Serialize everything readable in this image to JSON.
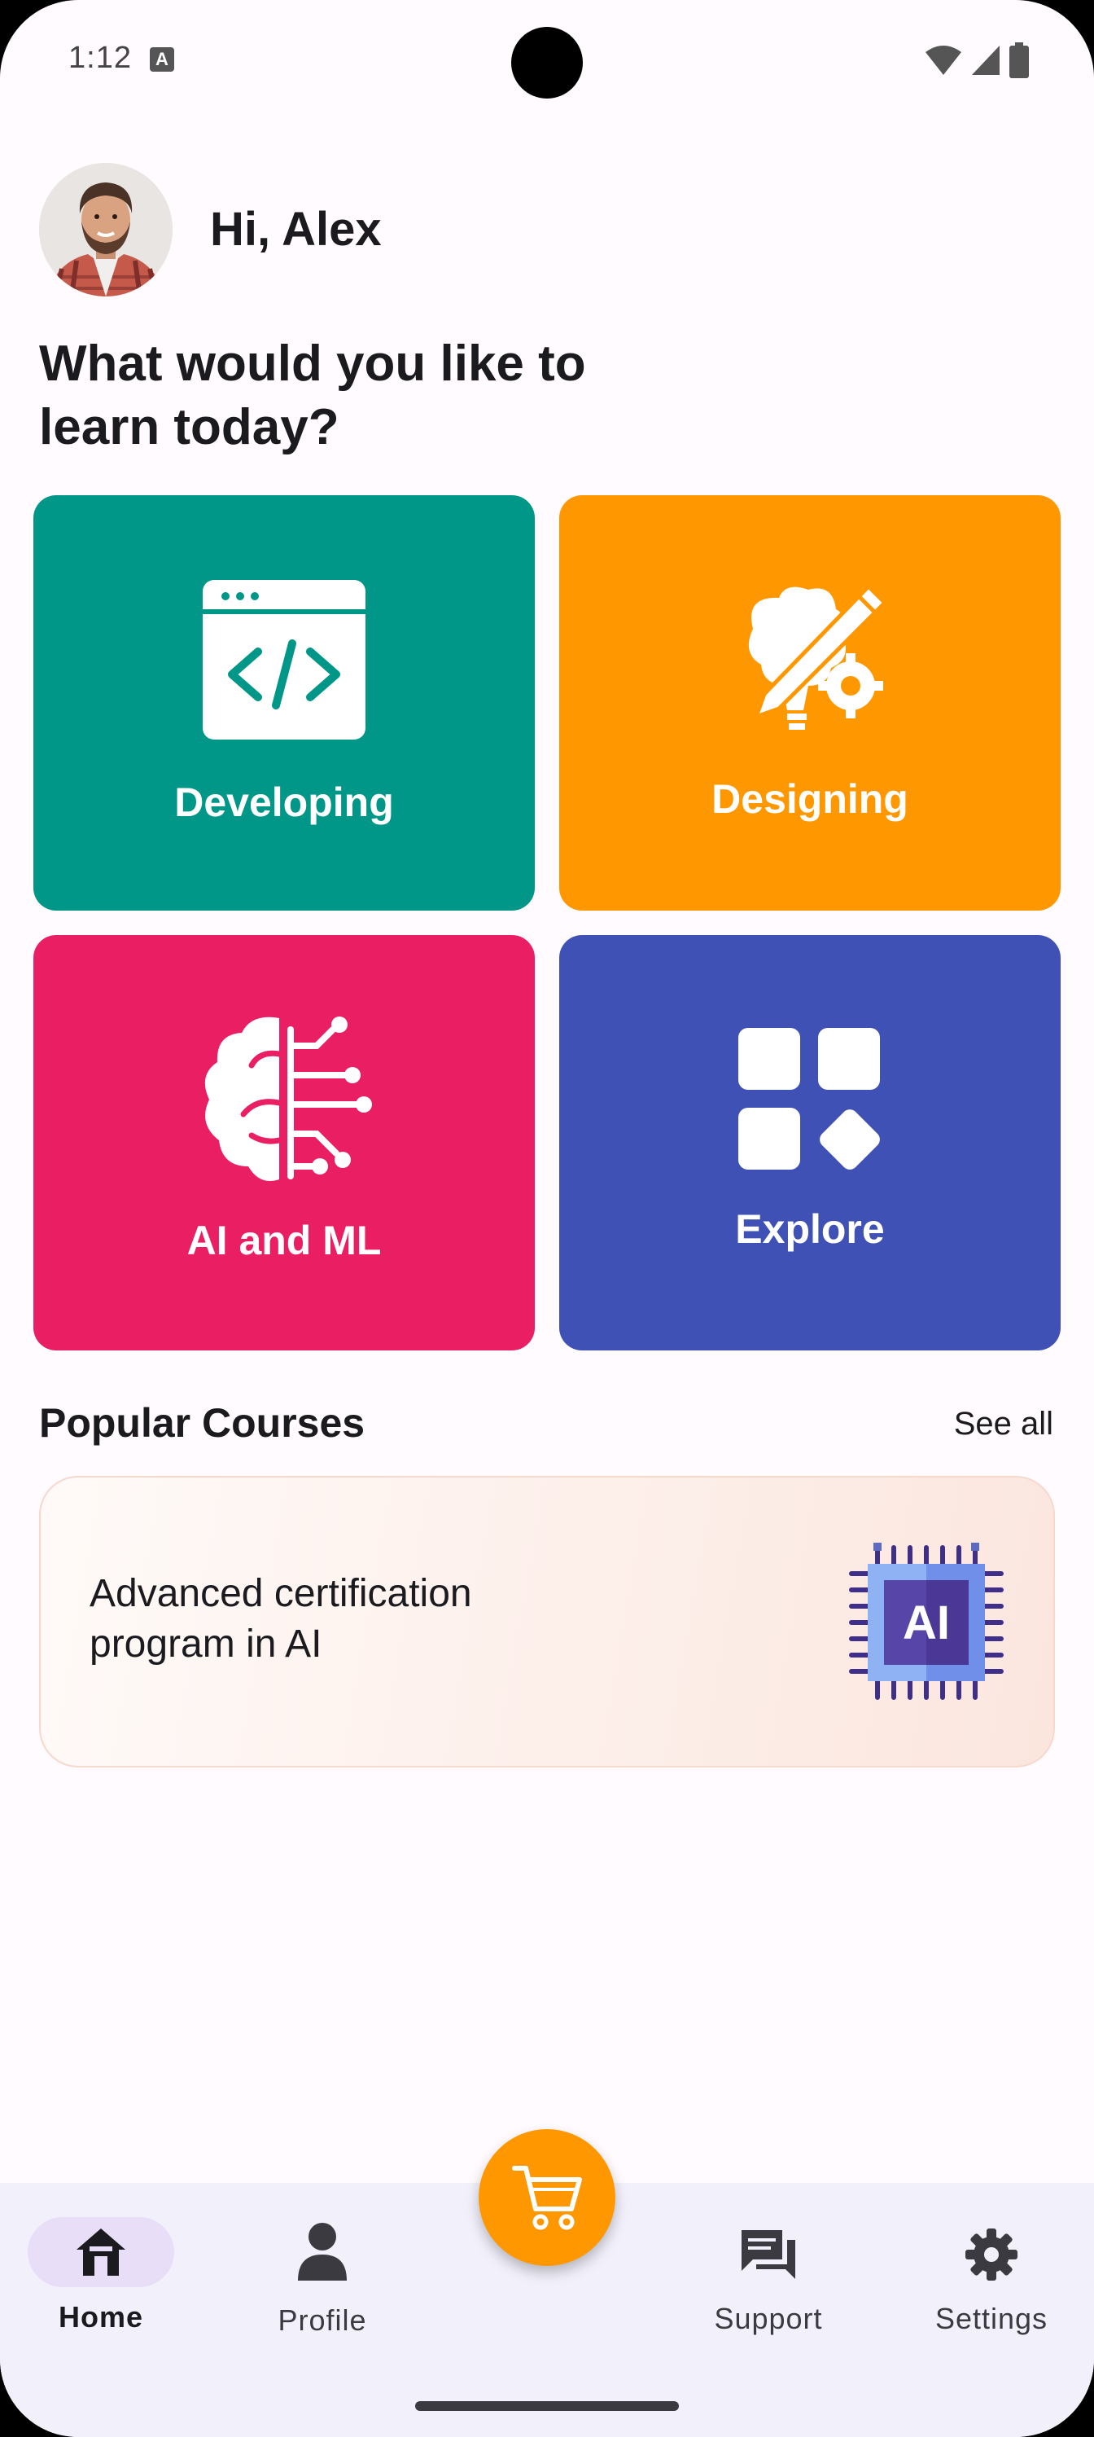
{
  "status_bar": {
    "time": "1:12",
    "notification_icon": "a-icon"
  },
  "user": {
    "greeting": "Hi, Alex",
    "avatar_icon": "avatar"
  },
  "headline": "What would you like to learn today?",
  "categories": [
    {
      "label": "Developing",
      "icon": "code-window-icon",
      "color": "#009688"
    },
    {
      "label": "Designing",
      "icon": "design-brain-pencil-icon",
      "color": "#ff9800"
    },
    {
      "label": "AI and ML",
      "icon": "brain-circuit-icon",
      "color": "#e91e63"
    },
    {
      "label": "Explore",
      "icon": "grid-apps-icon",
      "color": "#3f51b5"
    }
  ],
  "popular": {
    "title": "Popular Courses",
    "see_all": "See all",
    "courses": [
      {
        "title": "Advanced certification program in AI",
        "icon": "ai-chip-icon",
        "icon_text": "AI"
      }
    ]
  },
  "nav": {
    "items": [
      {
        "label": "Home",
        "icon": "home-icon",
        "active": true
      },
      {
        "label": "Profile",
        "icon": "person-icon",
        "active": false
      },
      {
        "label": "Support",
        "icon": "chat-icon",
        "active": false
      },
      {
        "label": "Settings",
        "icon": "gear-icon",
        "active": false
      }
    ],
    "fab_icon": "cart-icon"
  },
  "colors": {
    "accent": "#ff9800",
    "nav_background": "#f2f0fb",
    "nav_active_pill": "#e8def8"
  }
}
